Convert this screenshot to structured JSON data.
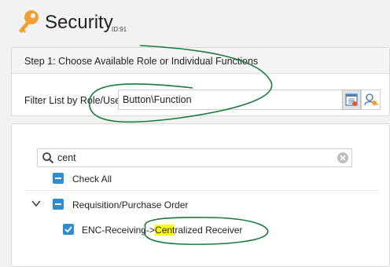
{
  "header": {
    "title": "Security",
    "page_id": "ID:91",
    "icon": "key-icon"
  },
  "step1": {
    "label": "Step 1: Choose Available Role or Individual Functions",
    "filter_label": "Filter List by Role/User",
    "filter_value": "Button\\Function",
    "buttons": [
      {
        "icon": "function-list-icon",
        "active": true
      },
      {
        "icon": "role-user-icon",
        "active": false
      }
    ]
  },
  "tree": {
    "search": {
      "value": "cent",
      "icon": "search-icon",
      "clear_icon": "clear-icon"
    },
    "check_all": "Check All",
    "groups": [
      {
        "label": "Requisition/Purchase Order",
        "expanded": true,
        "state": "partial",
        "items": [
          {
            "prefix": "ENC-Receiving->",
            "match": "Cent",
            "suffix": "ralized Receiver",
            "checked": true
          }
        ]
      }
    ]
  },
  "colors": {
    "accent": "#2f8ccd",
    "highlight": "#ffff00",
    "annotation": "#1a7a3a",
    "key_icon": "#f0a030"
  }
}
